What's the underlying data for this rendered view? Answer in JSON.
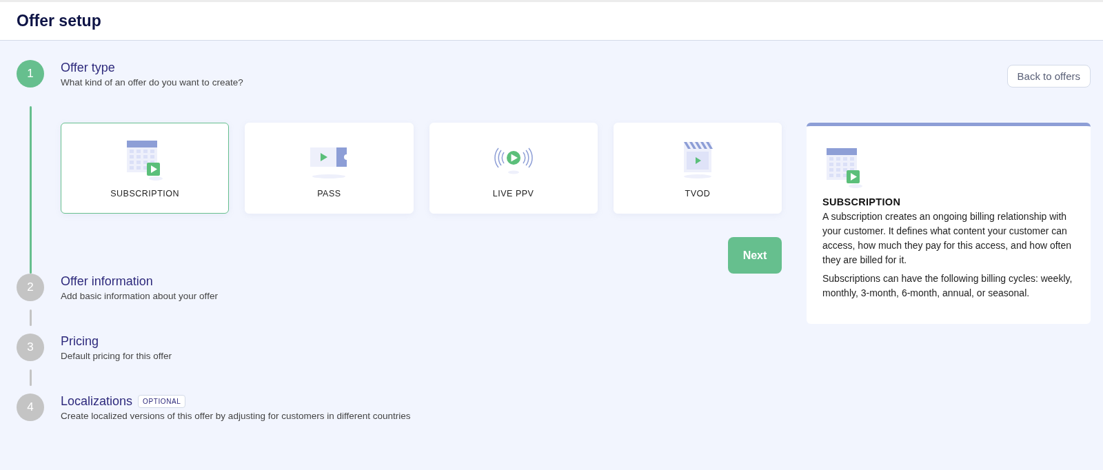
{
  "page": {
    "title": "Offer setup"
  },
  "back_button": "Back to offers",
  "steps": [
    {
      "number": "1",
      "title": "Offer type",
      "subtitle": "What kind of an offer do you want to create?",
      "selected": true
    },
    {
      "number": "2",
      "title": "Offer information",
      "subtitle": "Add basic information about your offer",
      "selected": false
    },
    {
      "number": "3",
      "title": "Pricing",
      "subtitle": "Default pricing for this offer",
      "selected": false
    },
    {
      "number": "4",
      "title": "Localizations",
      "badge": "OPTIONAL",
      "subtitle": "Create localized versions of this offer by adjusting for customers in different countries",
      "selected": false
    }
  ],
  "offer_types": [
    {
      "kind": "calendar",
      "label": "SUBSCRIPTION",
      "selected": true
    },
    {
      "kind": "ticket",
      "label": "PASS",
      "selected": false
    },
    {
      "kind": "broadcast",
      "label": "LIVE PPV",
      "selected": false
    },
    {
      "kind": "clapper",
      "label": "TVOD",
      "selected": false
    }
  ],
  "next_button": "Next",
  "info_panel": {
    "kind": "calendar",
    "title": "SUBSCRIPTION",
    "paragraphs": [
      "A subscription creates an ongoing billing relationship with your customer. It defines what content your customer can access, how much they pay for this access, and how often they are billed for it.",
      "Subscriptions can have the following billing cycles: weekly, monthly, 3-month, 6-month, annual, or seasonal."
    ]
  }
}
